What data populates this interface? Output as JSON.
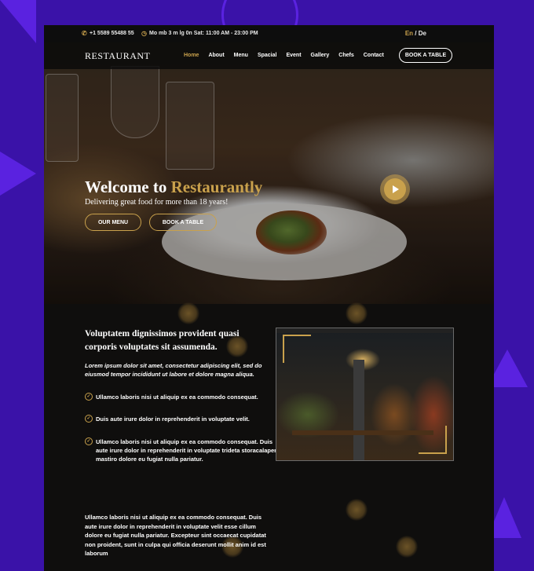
{
  "topbar": {
    "phone": "+1 5589 55488 55",
    "hours": "Mo mb 3 m lg 0n Sat: 11:00 AM - 23:00 PM",
    "lang_en": "En",
    "lang_sep": "/",
    "lang_de": "De"
  },
  "header": {
    "logo": "RESTAURANT",
    "nav": [
      "Home",
      "About",
      "Menu",
      "Spacial",
      "Event",
      "Gallery",
      "Chefs",
      "Contact"
    ],
    "book_label": "BOOK A TABLE"
  },
  "hero": {
    "title_prefix": "Welcome to",
    "title_brand": "Restaurantly",
    "subtitle": "Delivering great food for more than 18 years!",
    "btn_menu": "OUR MENU",
    "btn_book": "BOOK A TABLE"
  },
  "about": {
    "title": "Voluptatem dignissimos provident quasi corporis voluptates sit assumenda.",
    "lead": "Lorem ipsum dolor sit amet, consectetur adipiscing elit, sed do eiusmod tempor incididunt ut labore et dolore magna aliqua.",
    "checks": [
      "Ullamco laboris nisi ut aliquip ex ea commodo consequat.",
      "Duis aute irure dolor in reprehenderit in voluptate velit.",
      "Ullamco laboris nisi ut aliquip ex ea commodo consequat. Duis aute irure dolor in reprehenderit in voluptate trideta storacalaperda mastiro dolore eu fugiat nulla pariatur."
    ],
    "paragraph": "Ullamco laboris nisi ut aliquip ex ea commodo consequat. Duis aute irure dolor in reprehenderit in voluptate velit esse cillum dolore eu fugiat nulla pariatur. Excepteur sint occaecat cupidatat non proident, sunt in culpa qui officia deserunt mollit anim id est laborum"
  },
  "colors": {
    "accent": "#c9a14c",
    "page_bg": "#3a12a8",
    "site_bg": "#0b0b0c"
  },
  "icons": {
    "phone": "phone-icon",
    "clock": "clock-icon",
    "play": "play-icon",
    "check": "check-circle-icon"
  }
}
